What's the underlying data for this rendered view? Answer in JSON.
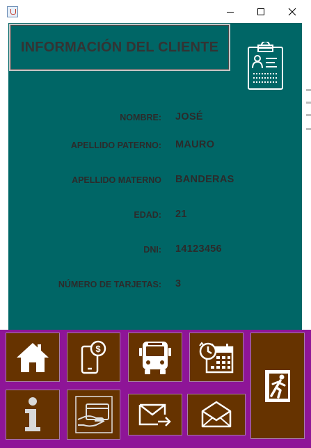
{
  "window": {
    "icon": "java-cup-icon",
    "controls": [
      "minimize-icon",
      "maximize-icon",
      "close-icon"
    ]
  },
  "header": {
    "title": "INFORMACIÓN DEL CLIENTE",
    "icon": "clipboard-user-icon"
  },
  "client": {
    "fields": [
      {
        "label": "NOMBRE:",
        "value": "JOSÉ"
      },
      {
        "label": "APELLIDO PATERNO:",
        "value": "MAURO"
      },
      {
        "label": "APELLIDO MATERNO",
        "value": "BANDERAS"
      },
      {
        "label": "EDAD:",
        "value": "21"
      },
      {
        "label": "DNI:",
        "value": "14123456"
      },
      {
        "label": "NÚMERO DE TARJETAS:",
        "value": "3"
      }
    ]
  },
  "toolbar": {
    "buttons": [
      "home-icon",
      "mobile-payment-icon",
      "bus-icon",
      "calendar-schedule-icon",
      "exit-icon",
      "info-icon",
      "card-payment-icon",
      "send-mail-icon",
      "open-mail-icon"
    ]
  },
  "colors": {
    "panel": "#006666",
    "toolbar": "#8e1597",
    "button": "#663300",
    "text": "#2b2b2b"
  }
}
